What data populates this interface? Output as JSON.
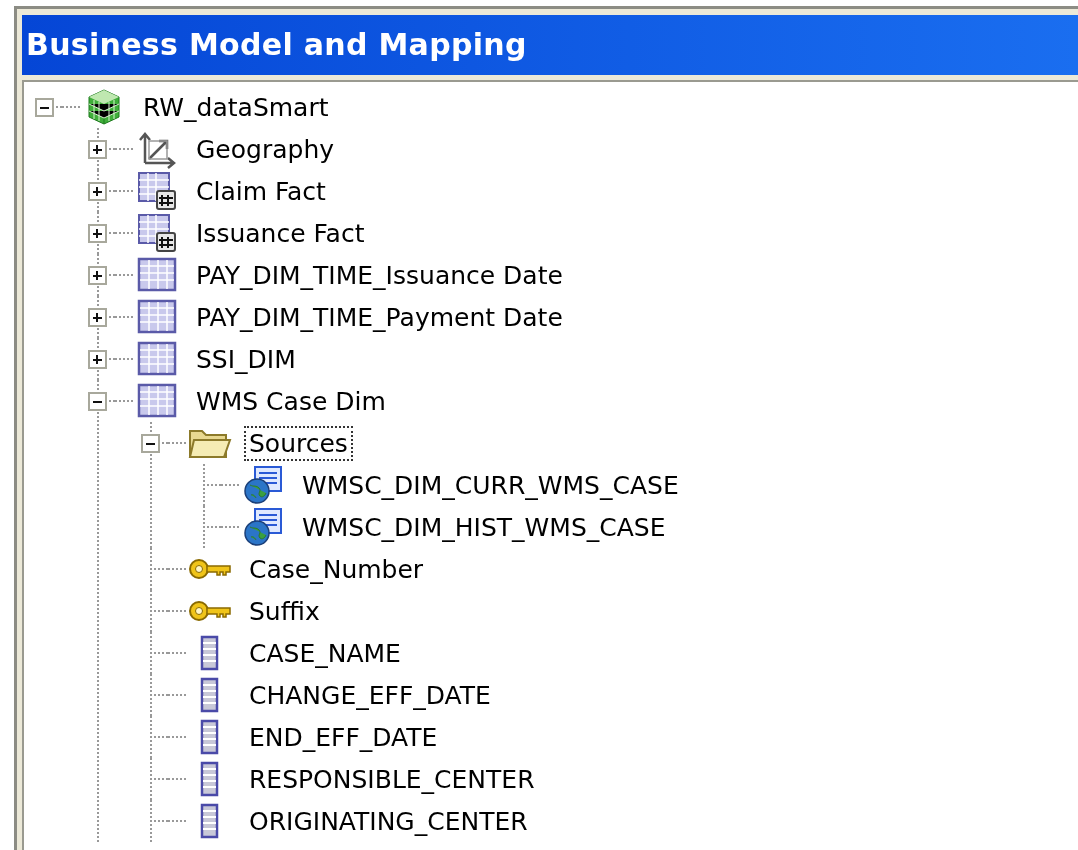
{
  "panel": {
    "title": "Business Model and Mapping"
  },
  "tree": [
    {
      "label": "RW_dataSmart",
      "kind": "model",
      "expanded": true,
      "selected": false,
      "children": [
        {
          "label": "Geography",
          "kind": "hierarchy",
          "expanded": false,
          "selected": false
        },
        {
          "label": "Claim Fact",
          "kind": "fact",
          "expanded": false,
          "selected": false
        },
        {
          "label": "Issuance Fact",
          "kind": "fact",
          "expanded": false,
          "selected": false
        },
        {
          "label": "PAY_DIM_TIME_Issuance Date",
          "kind": "table",
          "expanded": false,
          "selected": false
        },
        {
          "label": "PAY_DIM_TIME_Payment Date",
          "kind": "table",
          "expanded": false,
          "selected": false
        },
        {
          "label": "SSI_DIM",
          "kind": "table",
          "expanded": false,
          "selected": false
        },
        {
          "label": "WMS Case Dim",
          "kind": "table",
          "expanded": true,
          "selected": false,
          "children": [
            {
              "label": "Sources",
              "kind": "folder",
              "expanded": true,
              "selected": true,
              "children": [
                {
                  "label": "WMSC_DIM_CURR_WMS_CASE",
                  "kind": "source",
                  "selected": false
                },
                {
                  "label": "WMSC_DIM_HIST_WMS_CASE",
                  "kind": "source",
                  "selected": false
                }
              ]
            },
            {
              "label": "Case_Number",
              "kind": "key",
              "selected": false
            },
            {
              "label": "Suffix",
              "kind": "key",
              "selected": false
            },
            {
              "label": "CASE_NAME",
              "kind": "column",
              "selected": false
            },
            {
              "label": "CHANGE_EFF_DATE",
              "kind": "column",
              "selected": false
            },
            {
              "label": "END_EFF_DATE",
              "kind": "column",
              "selected": false
            },
            {
              "label": "RESPONSIBLE_CENTER",
              "kind": "column",
              "selected": false
            },
            {
              "label": "ORIGINATING_CENTER",
              "kind": "column",
              "selected": false
            }
          ]
        }
      ]
    }
  ]
}
